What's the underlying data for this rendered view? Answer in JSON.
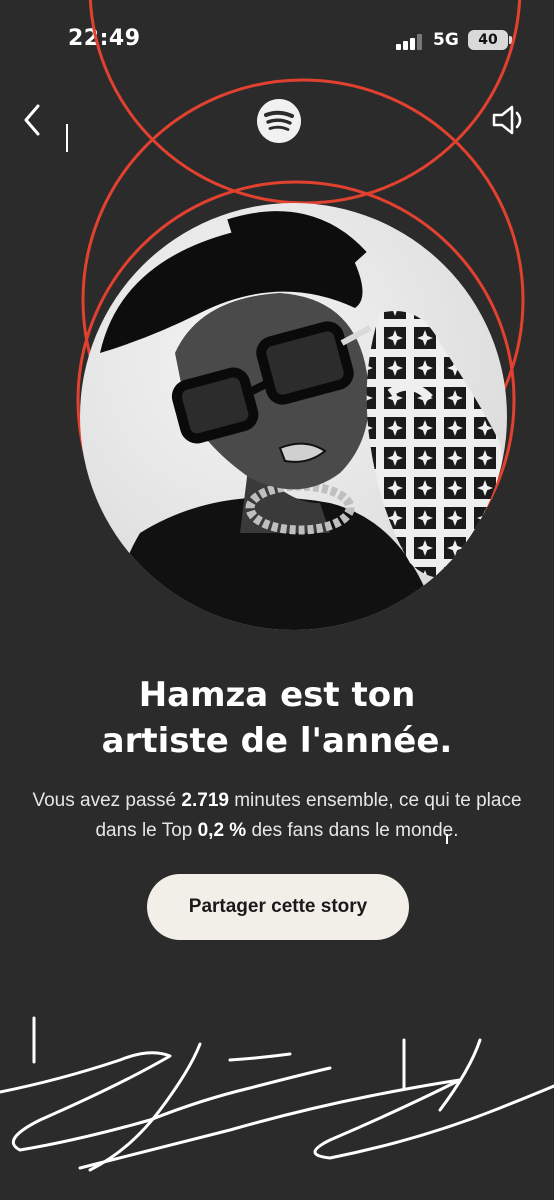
{
  "status_bar": {
    "time": "22:49",
    "network": "5G",
    "battery": "40"
  },
  "colors": {
    "background": "#2b2b2b",
    "accent_ring": "#e2412f",
    "button_bg": "#f1efe8"
  },
  "icons": {
    "back": "chevron-left-icon",
    "logo": "spotify-logo-icon",
    "sound": "speaker-icon"
  },
  "headline": {
    "line1": "Hamza est ton",
    "line2": "artiste de l'année."
  },
  "subtext": {
    "part1": "Vous avez passé ",
    "minutes": "2.719",
    "part2": " minutes ensemble, ce qui te place dans le Top ",
    "percent": "0,2 %",
    "part3": " des fans dans le monde."
  },
  "share_button": {
    "label": "Partager cette story"
  }
}
